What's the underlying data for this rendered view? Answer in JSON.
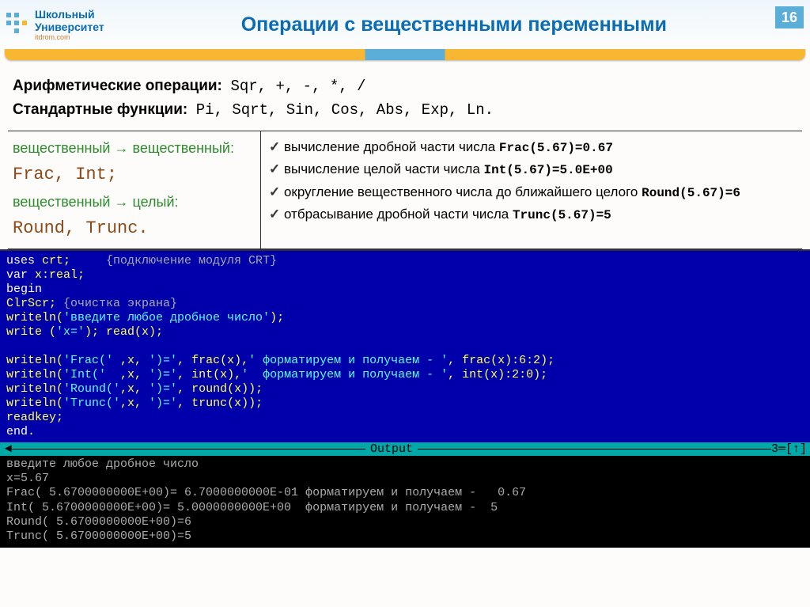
{
  "header": {
    "logoTop": "Школьный",
    "logoBottom": "Университет",
    "logoSub": "itdrom.com",
    "title": "Операции с вещественными переменными",
    "pageNumber": "16"
  },
  "arith": {
    "label": "Арифметические операции:",
    "ops": "Sqr, +, -, *, /"
  },
  "stdfunc": {
    "label": "Стандартные функции:",
    "funcs": "Pi, Sqrt, Sin, Cos, Abs, Exp, Ln."
  },
  "left": {
    "l1": "вещественный → вещественный:",
    "l2": "Frac, Int;",
    "l3": "вещественный → целый:",
    "l4": "Round, Trunc."
  },
  "bullets": {
    "b1a": "вычисление дробной части числа ",
    "b1b": "Frac(5.67)=0.67",
    "b2a": "вычисление целой части числа ",
    "b2b": "Int(5.67)=5.0E+00",
    "b3a": "округление вещественного числа до ближайшего целого ",
    "b3b": "Round(5.67)=6",
    "b4a": "отбрасывание дробной части числа ",
    "b4b": "Trunc(5.67)=5"
  },
  "editor": {
    "l1a": "uses",
    "l1b": " crt;     ",
    "l1c": "{подключение модуля CRT}",
    "l2a": "var",
    "l2b": " x:real;",
    "l3": "begin",
    "l4a": "ClrScr; ",
    "l4b": "{очистка экрана}",
    "l5a": "writeln(",
    "l5b": "'введите любое дробное число'",
    "l5c": ");",
    "l6a": "write (",
    "l6b": "'x='",
    "l6c": "); read(x);",
    "blank": "",
    "l7a": "writeln(",
    "l7b": "'Frac('",
    "l7c": " ,x, ",
    "l7d": "')='",
    "l7e": ", frac(x),",
    "l7f": "' форматируем и получаем - '",
    "l7g": ", frac(x):6:2);",
    "l8a": "writeln(",
    "l8b": "'Int('",
    "l8c": "  ,x, ",
    "l8d": "')='",
    "l8e": ", int(x),",
    "l8f": "'  форматируем и получаем - '",
    "l8g": ", int(x):2:0);",
    "l9a": "writeln(",
    "l9b": "'Round('",
    "l9c": ",x, ",
    "l9d": "')='",
    "l9e": ", round(x));",
    "l10a": "writeln(",
    "l10b": "'Trunc('",
    "l10c": ",x, ",
    "l10d": "')='",
    "l10e": ", trunc(x));",
    "l11": "readkey;",
    "l12a": "end",
    "l12b": "."
  },
  "outputBar": {
    "left": "═",
    "label": " Output ",
    "right": "3═[↑]"
  },
  "console": {
    "l1": "введите любое дробное число",
    "l2": "x=5.67",
    "l3": "Frac( 5.6700000000E+00)= 6.7000000000E-01 форматируем и получаем -   0.67",
    "l4": "Int( 5.6700000000E+00)= 5.0000000000E+00  форматируем и получаем -  5",
    "l5": "Round( 5.6700000000E+00)=6",
    "l6": "Trunc( 5.6700000000E+00)=5"
  }
}
